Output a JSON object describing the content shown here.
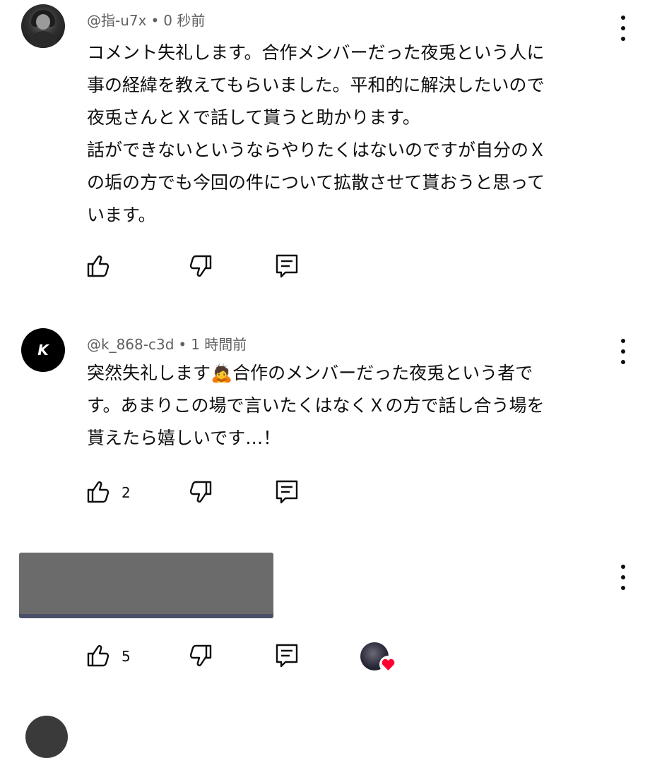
{
  "comments": [
    {
      "username": "@指-u7x",
      "separator": "•",
      "time": "0 秒前",
      "text": "コメント失礼します。合作メンバーだった夜兎という人に\n事の経緯を教えてもらいました。平和的に解決したいので\n夜兎さんとＸで話して貰うと助かります。\n話ができないというならやりたくはないのですが自分のＸ\nの垢の方でも今回の件について拡散させて貰おうと思って\nいます。",
      "likes": ""
    },
    {
      "username": "@k_868-c3d",
      "separator": "•",
      "time": "1 時間前",
      "text_before_emoji": "突然失礼します",
      "emoji": "🙇",
      "text_after_emoji": "合作のメンバーだった夜兎という者で\nす。あまりこの場で言いたくはなくＸの方で話し合う場を\n貰えたら嬉しいです…！",
      "likes": "2",
      "avatar_logo": "K"
    },
    {
      "username": "",
      "time": "",
      "text": "",
      "likes": "5",
      "creator_heart": true
    }
  ],
  "icons": {
    "like": "thumbs-up-icon",
    "dislike": "thumbs-down-icon",
    "reply": "reply-comment-icon",
    "menu": "more-vertical-icon",
    "heart": "heart-icon"
  },
  "colors": {
    "text": "#0f0f0f",
    "meta": "#606060",
    "heart": "#ff0033",
    "redaction": "#6b6b6b"
  }
}
